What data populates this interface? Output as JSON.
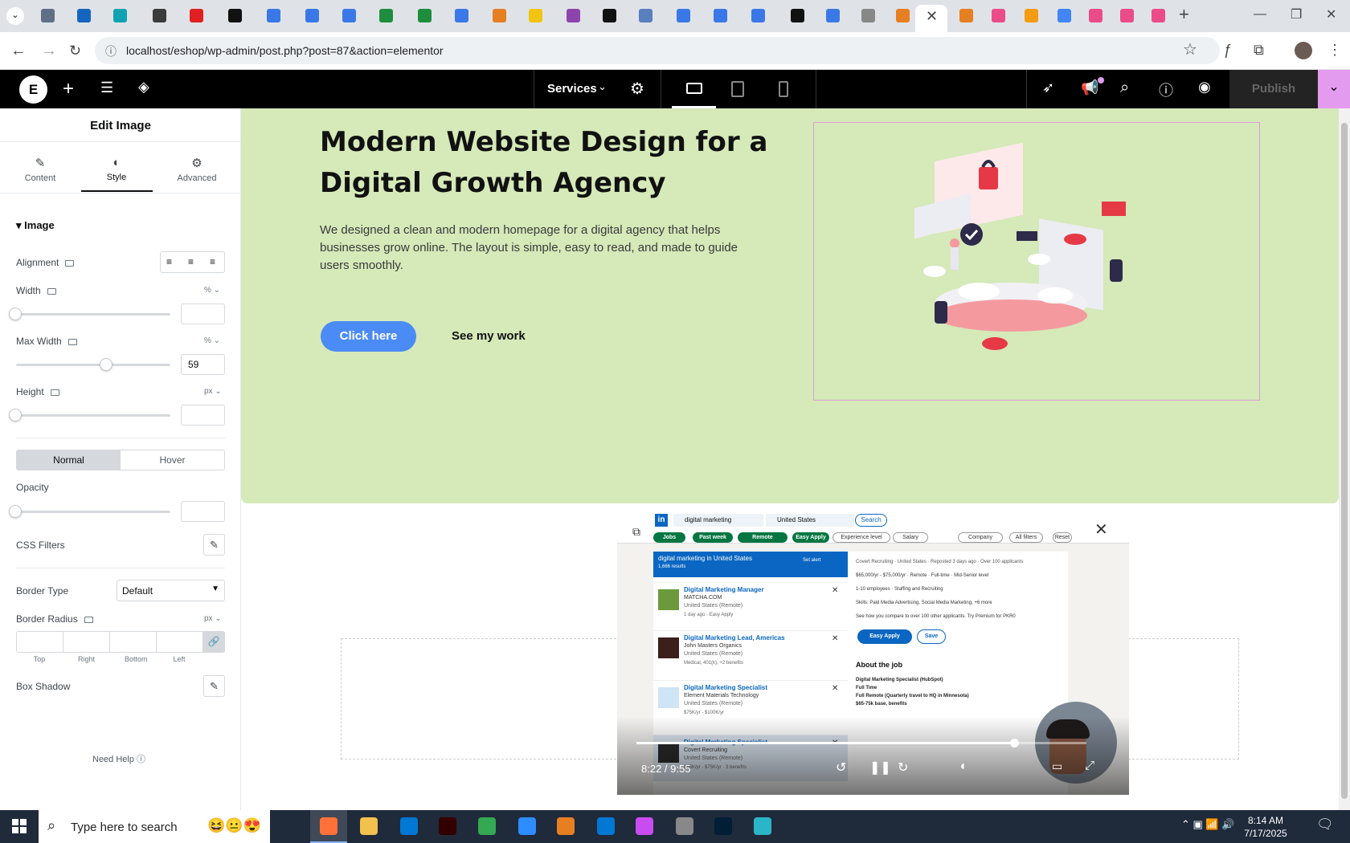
{
  "browser": {
    "url": "localhost/eshop/wp-admin/post.php?post=87&action=elementor"
  },
  "editor_topbar": {
    "page_name": "Services",
    "publish_label": "Publish"
  },
  "panel": {
    "title": "Edit Image",
    "tabs": [
      {
        "label": "Content"
      },
      {
        "label": "Style"
      },
      {
        "label": "Advanced"
      }
    ],
    "section_title": "Image",
    "alignment_label": "Alignment",
    "width_label": "Width",
    "width_unit": "%",
    "max_width_label": "Max Width",
    "max_width_unit": "%",
    "max_width_value": "59",
    "height_label": "Height",
    "height_unit": "px",
    "normal_label": "Normal",
    "hover_label": "Hover",
    "opacity_label": "Opacity",
    "css_filters_label": "CSS Filters",
    "border_type_label": "Border Type",
    "border_type_value": "Default",
    "border_radius_label": "Border Radius",
    "border_radius_unit": "px",
    "radius_fields": [
      "Top",
      "Right",
      "Bottom",
      "Left"
    ],
    "box_shadow_label": "Box Shadow",
    "need_help": "Need Help"
  },
  "hero": {
    "title": "Modern Website Design for a Digital Growth Agency",
    "description": "We designed a clean and modern homepage for a digital agency that helps businesses grow online. The layout is simple, easy to read, and made to guide users smoothly.",
    "cta_primary": "Click here",
    "cta_secondary": "See my work"
  },
  "video": {
    "time": "8:22 / 9:55",
    "progress": 0.84,
    "search_query": "digital marketing",
    "location": "United States",
    "search_button": "Search",
    "filters": [
      "Jobs",
      "Past week",
      "Remote",
      "Easy Apply",
      "Experience level",
      "Salary",
      "Company",
      "All filters",
      "Reset"
    ],
    "results_header": "digital marketing in United States",
    "results_count": "1,666 results",
    "set_alert": "Set alert",
    "jobs": [
      {
        "title": "Digital Marketing Manager",
        "company": "MATCHA.COM",
        "location": "United States (Remote)",
        "meta": "1 day ago · Easy Apply"
      },
      {
        "title": "Digital Marketing Lead, Americas",
        "company": "John Masters Organics",
        "location": "United States (Remote)",
        "meta": "Medical, 401(k), +2 benefits"
      },
      {
        "title": "Digital Marketing Specialist",
        "company": "Element Materials Technology",
        "location": "United States (Remote)",
        "meta": "$75K/yr - $100K/yr"
      },
      {
        "title": "Digital Marketing Specialist",
        "company": "Covert Recruiting",
        "location": "United States (Remote)",
        "meta": "$65K/yr - $75K/yr · 3 benefits"
      }
    ],
    "detail": {
      "company_line": "Covert Recruiting · United States · Reposted 3 days ago · Over 100 applicants",
      "salary": "$65,000/yr - $75,000/yr",
      "tags": [
        "Remote",
        "Full-time",
        "Mid-Senior level"
      ],
      "size": "1-10 employees · Staffing and Recruiting",
      "skills": "Skills: Paid Media Advertising, Social Media Marketing, +6 more",
      "compare": "See how you compare to over 100 other applicants. Try Premium for PKR0",
      "easy_apply": "Easy Apply",
      "save": "Save",
      "about": "About the job",
      "lines": [
        "Digital Marketing Specialist (HubSpot)",
        "Full Time",
        "Full Remote (Quarterly travel to HQ in Minnesota)",
        "$65-75k base, benefits"
      ]
    }
  },
  "taskbar": {
    "search_placeholder": "Type here to search",
    "time": "8:14 AM",
    "date": "7/17/2025"
  }
}
